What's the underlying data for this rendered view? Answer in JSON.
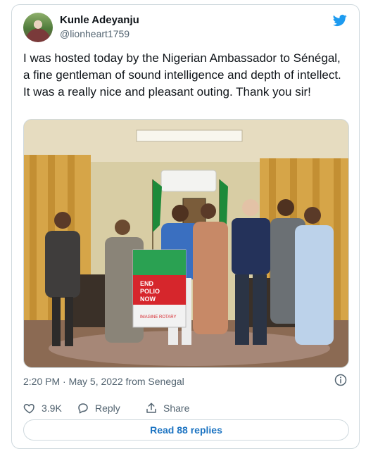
{
  "author": {
    "name": "Kunle Adeyanju",
    "handle": "@lionheart1759"
  },
  "tweet": {
    "text": "I was hosted today by the Nigerian Ambassador to Sénégal, a fine gentleman of sound intelligence and depth of intellect. It was a really nice and pleasant outing. Thank you sir!",
    "timestamp": "2:20 PM · May 5, 2022 from Senegal"
  },
  "photo": {
    "banner_text": [
      "END",
      "POLIO",
      "NOW"
    ],
    "banner_text_lower": "IMAGINE ROTARY"
  },
  "actions": {
    "likes": "3.9K",
    "reply_label": "Reply",
    "share_label": "Share"
  },
  "read_replies": "Read 88 replies",
  "colors": {
    "twitter_blue": "#1d9bf0",
    "link_blue": "#1d74c2",
    "text": "#0f1419",
    "muted": "#536471",
    "border": "#cfd9de"
  },
  "icons": [
    "twitter-bird-icon",
    "info-icon",
    "heart-icon",
    "reply-icon",
    "share-icon"
  ]
}
